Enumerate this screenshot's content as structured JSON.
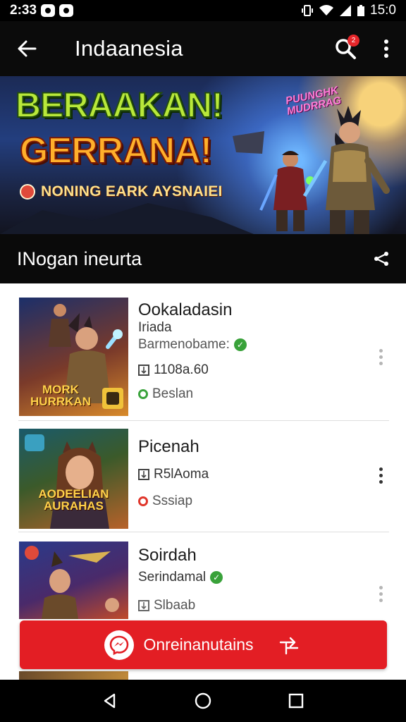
{
  "status_bar": {
    "time": "2:33",
    "right_time": "15:0"
  },
  "app_bar": {
    "title": "Indaanesia",
    "notification_count": "2"
  },
  "banner": {
    "headline_1": "BERAAKAN!",
    "headline_2": "GERRANA!",
    "subline": "NONING EARK AYSNAIEI",
    "logo_text": "PUUNGHK MUDRRAG"
  },
  "section": {
    "title": "INogan ineurta"
  },
  "items": [
    {
      "title": "Ookaladasin",
      "subtitle": "Iriada",
      "publisher": "Barmenobame:",
      "meta": "1108a.60",
      "status": "Beslan",
      "thumb_caption": "MORK HURRKAN"
    },
    {
      "title": "Picenah",
      "meta": "R5lAoma",
      "status": "Sssiap",
      "thumb_caption": "AODEELIAN AURAHAS"
    },
    {
      "title": "Soirdah",
      "publisher": "Serindamal",
      "meta": "Slbaab"
    }
  ],
  "cta": {
    "label": "Onreinanutains"
  },
  "colors": {
    "accent": "#e31e24",
    "verified": "#39a23a"
  }
}
